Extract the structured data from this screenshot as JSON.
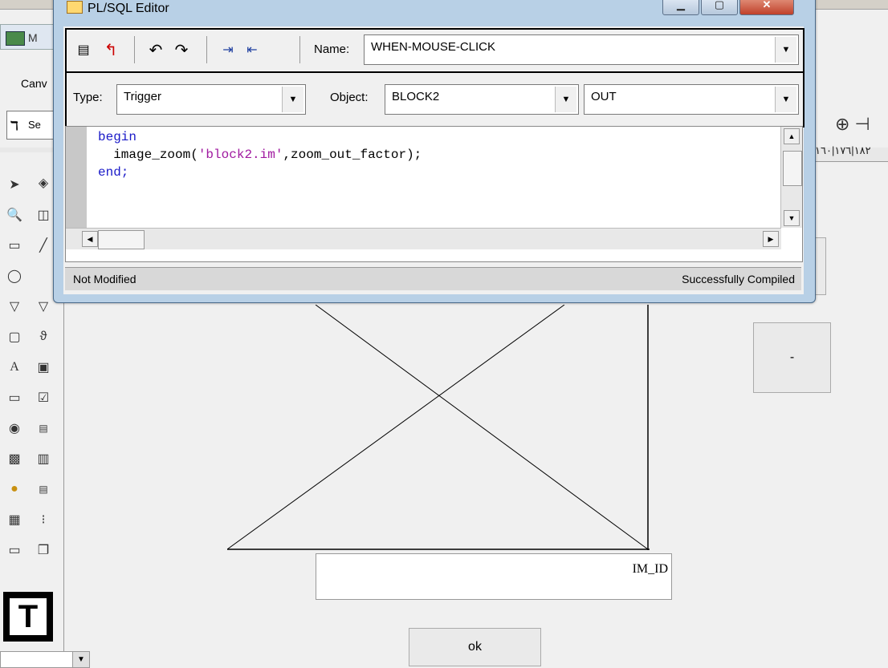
{
  "editor_window": {
    "title": "PL/SQL Editor",
    "name_label": "Name:",
    "name_value": "WHEN-MOUSE-CLICK",
    "type_label": "Type:",
    "type_value": "Trigger",
    "object_label": "Object:",
    "object_value": "BLOCK2",
    "object2_value": "OUT",
    "code": {
      "line1": "begin",
      "line2_pre": "  image_zoom(",
      "line2_str": "'block2.im'",
      "line2_post": ",zoom_out_factor);",
      "line3": "end;"
    },
    "status_left": "Not Modified",
    "status_right": "Successfully Compiled",
    "icons": [
      "compile-icon",
      "revert-icon",
      "undo-icon",
      "redo-icon",
      "indent-icon",
      "outdent-icon"
    ]
  },
  "builder": {
    "mdi_title": "M",
    "menu_left": "Canv",
    "font_combo": "Se",
    "im_id_label": "IM_ID",
    "minus_button": "-",
    "ok_button": "ok",
    "right_ruler": "١٨٢|١٧٦|١٦٠"
  }
}
